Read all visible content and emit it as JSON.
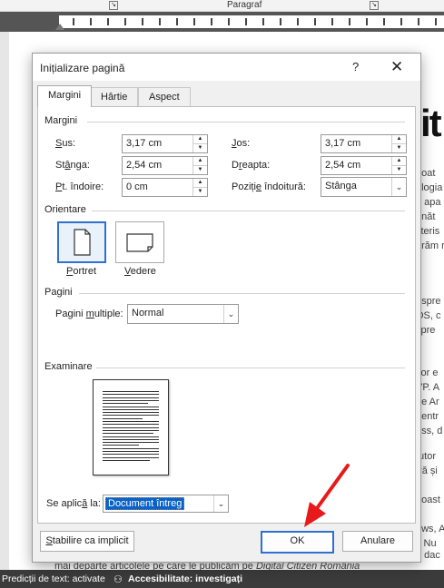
{
  "ribbon": {
    "group_label": "Paragraf"
  },
  "document": {
    "fragments": [
      "poat",
      "ologia",
      "e apa",
      "unăt",
      "cteris",
      "erăm r",
      "espre",
      "OS, c",
      "spre",
      "itor e",
      "VP. A",
      "pe Ar",
      "pentr",
      "ess, d",
      "tutor",
      "tră și",
      "noast",
      "ows, A",
      "i. Nu",
      "n dac"
    ],
    "bottom_line": "mai departe articolele pe care le publicăm pe",
    "bottom_line_italic": "Digital Citizen România",
    "big_letters": "it"
  },
  "statusbar": {
    "predictions": "Predicții de text: activate",
    "accessibility": "Accesibilitate: investigați"
  },
  "dialog": {
    "title": "Inițializare pagină",
    "help": "?",
    "close": "✕",
    "tabs": [
      {
        "label": "Margini"
      },
      {
        "label": "Hârtie"
      },
      {
        "label": "Aspect"
      }
    ],
    "margins": {
      "section": "Margini",
      "top_label_u": "S",
      "top_label": "us:",
      "top_value": "3,17 cm",
      "bottom_label_u": "J",
      "bottom_label": "os:",
      "bottom_value": "3,17 cm",
      "left_label_pre": "St",
      "left_label_u": "â",
      "left_label": "nga:",
      "left_value": "2,54 cm",
      "right_label_pre": "D",
      "right_label_u": "r",
      "right_label": "eapta:",
      "right_value": "2,54 cm",
      "gutter_label_u": "P",
      "gutter_label": "t. îndoire:",
      "gutter_value": "0 cm",
      "gutter_pos_label_pre": "Poziți",
      "gutter_pos_label_u": "e",
      "gutter_pos_label": " îndoitură:",
      "gutter_pos_value": "Stânga"
    },
    "orientation": {
      "section": "Orientare",
      "portrait_u": "P",
      "portrait": "ortret",
      "landscape_u": "V",
      "landscape": "edere"
    },
    "pages": {
      "section": "Pagini",
      "multiple_label_pre": "Pagini ",
      "multiple_label_u": "m",
      "multiple_label": "ultiple:",
      "multiple_value": "Normal"
    },
    "preview": {
      "section": "Examinare"
    },
    "apply": {
      "label_pre": "Se aplic",
      "label_u": "ă",
      "label": " la:",
      "value": "Document întreg"
    },
    "buttons": {
      "default_label_pre": "",
      "default_label_u": "S",
      "default_label": "tabilire ca implicit",
      "ok": "OK",
      "cancel": "Anulare"
    }
  },
  "colors": {
    "accent": "#2f6fcf",
    "annotation_arrow": "#e8191b"
  }
}
